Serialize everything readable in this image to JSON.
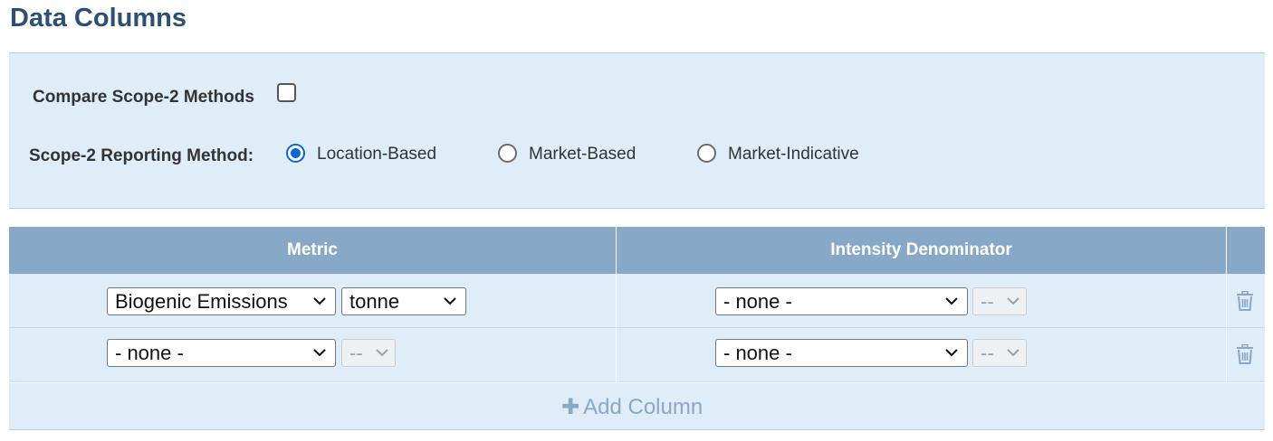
{
  "page": {
    "title": "Data Columns"
  },
  "options": {
    "compare_label": "Compare Scope-2 Methods",
    "compare_checked": false,
    "method_label": "Scope-2 Reporting Method:",
    "methods": [
      {
        "label": "Location-Based",
        "selected": true
      },
      {
        "label": "Market-Based",
        "selected": false
      },
      {
        "label": "Market-Indicative",
        "selected": false
      }
    ]
  },
  "table": {
    "headers": {
      "metric": "Metric",
      "denominator": "Intensity Denominator"
    },
    "rows": [
      {
        "metric": "Biogenic Emissions",
        "unit": "tonne",
        "unit_disabled": false,
        "denominator": "- none -",
        "denominator_unit": "--"
      },
      {
        "metric": "- none -",
        "unit": "--",
        "unit_disabled": true,
        "denominator": "- none -",
        "denominator_unit": "--"
      }
    ],
    "add_column_label": "Add Column"
  },
  "colors": {
    "title": "#2e4f74",
    "panel_bg": "#deedf7",
    "header_bg": "#87a9c7",
    "radio_accent": "#0a66d8",
    "add_link": "#8aa8c4"
  },
  "icons": {
    "checkbox": "checkbox-icon",
    "chevron": "chevron-down-icon",
    "trash": "trash-icon",
    "plus": "plus-icon"
  }
}
